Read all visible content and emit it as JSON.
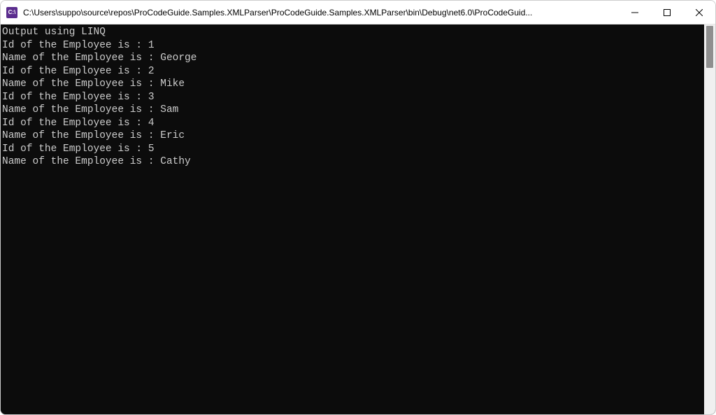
{
  "window": {
    "icon_label": "C:\\",
    "title": "C:\\Users\\suppo\\source\\repos\\ProCodeGuide.Samples.XMLParser\\ProCodeGuide.Samples.XMLParser\\bin\\Debug\\net6.0\\ProCodeGuid..."
  },
  "console": {
    "header": "Output using LINQ",
    "employees": [
      {
        "id": "1",
        "name": "George"
      },
      {
        "id": "2",
        "name": "Mike"
      },
      {
        "id": "3",
        "name": "Sam"
      },
      {
        "id": "4",
        "name": "Eric"
      },
      {
        "id": "5",
        "name": "Cathy"
      }
    ],
    "id_prefix": "Id of the Employee is : ",
    "name_prefix": "Name of the Employee is : "
  }
}
